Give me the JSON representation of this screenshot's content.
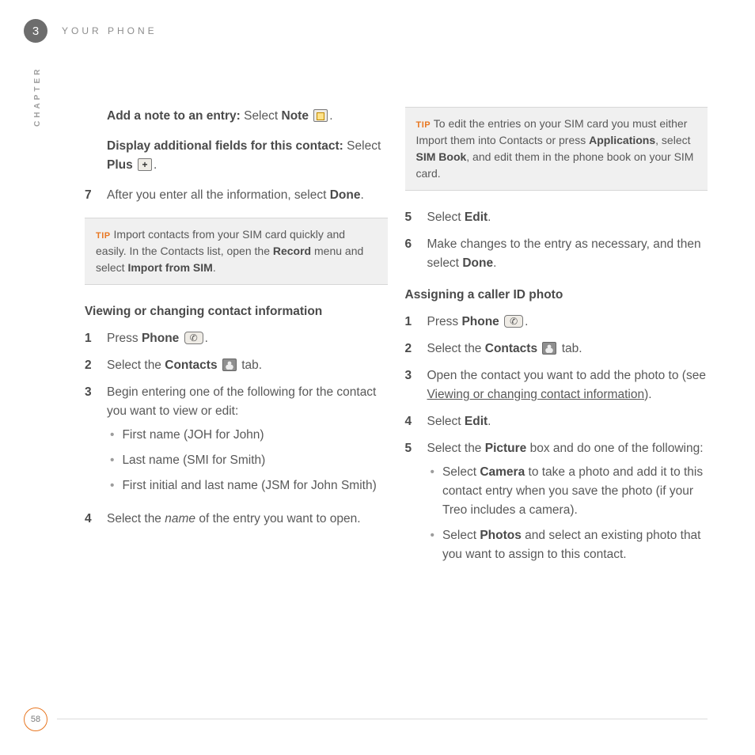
{
  "header": {
    "chapter_number": "3",
    "title": "YOUR PHONE",
    "chapter_label": "CHAPTER"
  },
  "left": {
    "note_entry_bold": "Add a note to an entry:",
    "note_entry_text": " Select ",
    "note_word": "Note",
    "display_fields_bold": "Display additional fields for this contact:",
    "display_fields_text": " Select ",
    "plus_word": "Plus",
    "step7_num": "7",
    "step7_a": "After you enter all the information, select ",
    "step7_done": "Done",
    "tip1_label": "TIP",
    "tip1_a": " Import contacts from your SIM card quickly and easily. In the Contacts list, open the ",
    "tip1_record": "Record",
    "tip1_b": " menu and select ",
    "tip1_import": "Import from SIM",
    "section1": "Viewing or changing contact information",
    "s1_1_num": "1",
    "s1_1_a": "Press ",
    "s1_1_phone": "Phone",
    "s1_2_num": "2",
    "s1_2_a": "Select the ",
    "s1_2_contacts": "Contacts",
    "s1_2_b": " tab.",
    "s1_3_num": "3",
    "s1_3_a": "Begin entering one of the following for the contact you want to view or edit:",
    "s1_3_b1": "First name (JOH for John)",
    "s1_3_b2": "Last name (SMI for Smith)",
    "s1_3_b3": "First initial and last name (JSM for John Smith)",
    "s1_4_num": "4",
    "s1_4_a": "Select the ",
    "s1_4_name": "name",
    "s1_4_b": " of the entry you want to open."
  },
  "right": {
    "tip2_label": "TIP",
    "tip2_a": " To edit the entries on your SIM card you must either Import them into Contacts or press ",
    "tip2_apps": "Applications",
    "tip2_b": ", select ",
    "tip2_sim": "SIM Book",
    "tip2_c": ", and edit them in the phone book on your SIM card.",
    "s2_5_num": "5",
    "s2_5_a": "Select ",
    "s2_5_edit": "Edit",
    "s2_6_num": "6",
    "s2_6_a": "Make changes to the entry as necessary, and then select ",
    "s2_6_done": "Done",
    "section2": "Assigning a caller ID photo",
    "s3_1_num": "1",
    "s3_1_a": "Press ",
    "s3_1_phone": "Phone",
    "s3_2_num": "2",
    "s3_2_a": "Select the ",
    "s3_2_contacts": "Contacts",
    "s3_2_b": " tab.",
    "s3_3_num": "3",
    "s3_3_a": "Open the contact you want to add the photo to (see ",
    "s3_3_link": "Viewing or changing contact information",
    "s3_3_b": ").",
    "s3_4_num": "4",
    "s3_4_a": "Select ",
    "s3_4_edit": "Edit",
    "s3_5_num": "5",
    "s3_5_a": "Select the ",
    "s3_5_pic": "Picture",
    "s3_5_b": " box and do one of the following:",
    "s3_5_b1a": "Select ",
    "s3_5_b1_cam": "Camera",
    "s3_5_b1b": " to take a photo and add it to this contact entry when you save the photo (if your Treo includes a camera).",
    "s3_5_b2a": "Select ",
    "s3_5_b2_ph": "Photos",
    "s3_5_b2b": " and select an existing photo that you want to assign to this contact."
  },
  "page_number": "58"
}
